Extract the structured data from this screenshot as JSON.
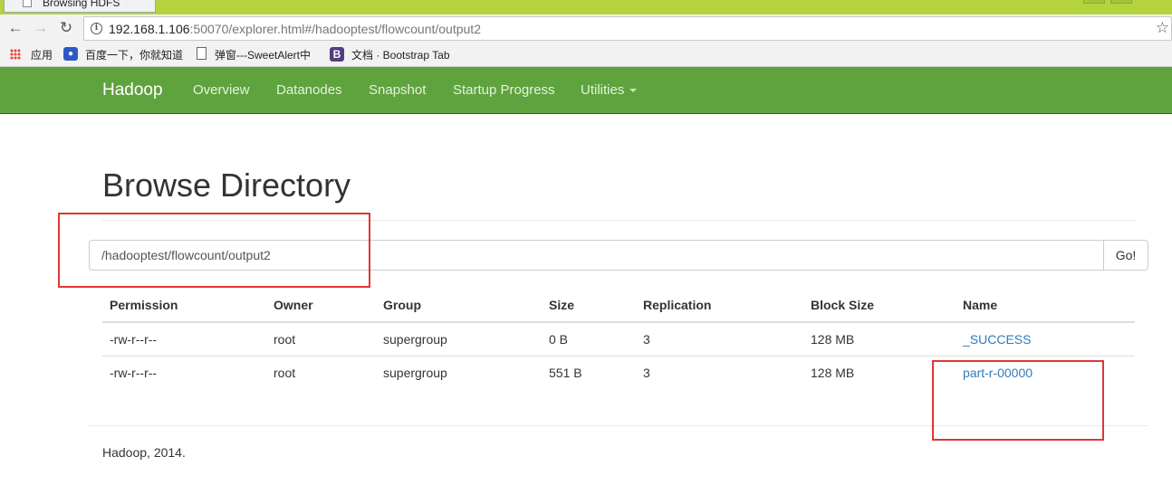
{
  "browser": {
    "tab_title": "Browsing HDFS",
    "url_host": "192.168.1.106",
    "url_rest": ":50070/explorer.html#/hadooptest/flowcount/output2",
    "bookmarks": [
      "应用",
      "百度一下，你就知道",
      "弹窗---SweetAlert中",
      "文档 · Bootstrap Tab"
    ]
  },
  "navbar": {
    "brand": "Hadoop",
    "links": [
      "Overview",
      "Datanodes",
      "Snapshot",
      "Startup Progress",
      "Utilities"
    ]
  },
  "page": {
    "title": "Browse Directory",
    "path_value": "/hadooptest/flowcount/output2",
    "go_label": "Go!"
  },
  "table": {
    "headers": [
      "Permission",
      "Owner",
      "Group",
      "Size",
      "Replication",
      "Block Size",
      "Name"
    ],
    "rows": [
      [
        "-rw-r--r--",
        "root",
        "supergroup",
        "0 B",
        "3",
        "128 MB",
        "_SUCCESS"
      ],
      [
        "-rw-r--r--",
        "root",
        "supergroup",
        "551 B",
        "3",
        "128 MB",
        "part-r-00000"
      ]
    ]
  },
  "footer": "Hadoop, 2014.",
  "colors": {
    "navbar": "#5fa33e",
    "link": "#337ab7",
    "annotation": "#e03535"
  }
}
